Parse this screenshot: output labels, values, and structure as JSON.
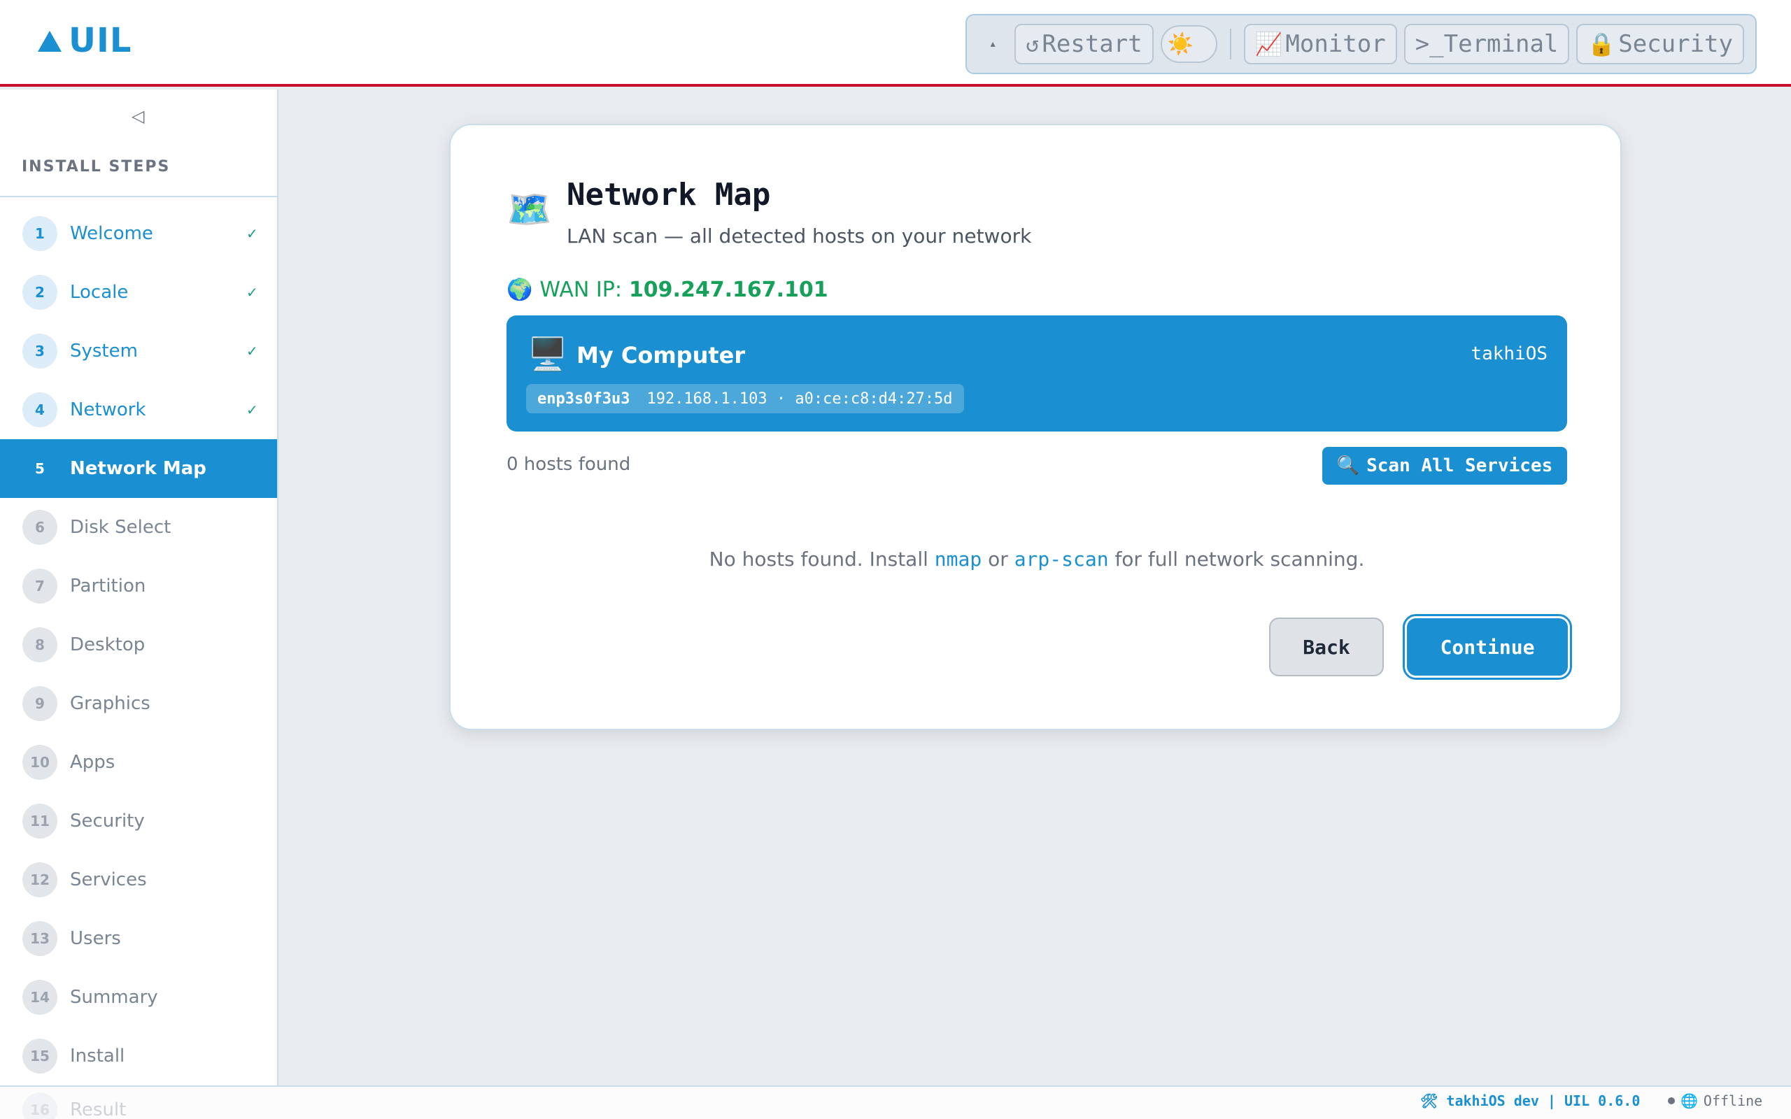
{
  "header": {
    "logo": "UIL",
    "toolbar": {
      "caret": "▴",
      "restart_icon": "↺",
      "restart_label": "Restart",
      "theme_icon": "☀️",
      "monitor_icon": "📈",
      "monitor_label": "Monitor",
      "terminal_label": ">_Terminal",
      "security_icon": "🔒",
      "security_label": "Security"
    }
  },
  "sidebar": {
    "collapse_icon": "◁",
    "title": "INSTALL STEPS",
    "steps": [
      {
        "num": "1",
        "label": "Welcome",
        "state": "done",
        "check": "✓"
      },
      {
        "num": "2",
        "label": "Locale",
        "state": "done",
        "check": "✓"
      },
      {
        "num": "3",
        "label": "System",
        "state": "done",
        "check": "✓"
      },
      {
        "num": "4",
        "label": "Network",
        "state": "done",
        "check": "✓"
      },
      {
        "num": "5",
        "label": "Network Map",
        "state": "active",
        "check": ""
      },
      {
        "num": "6",
        "label": "Disk Select",
        "state": "pending",
        "check": ""
      },
      {
        "num": "7",
        "label": "Partition",
        "state": "pending",
        "check": ""
      },
      {
        "num": "8",
        "label": "Desktop",
        "state": "pending",
        "check": ""
      },
      {
        "num": "9",
        "label": "Graphics",
        "state": "pending",
        "check": ""
      },
      {
        "num": "10",
        "label": "Apps",
        "state": "pending",
        "check": ""
      },
      {
        "num": "11",
        "label": "Security",
        "state": "pending",
        "check": ""
      },
      {
        "num": "12",
        "label": "Services",
        "state": "pending",
        "check": ""
      },
      {
        "num": "13",
        "label": "Users",
        "state": "pending",
        "check": ""
      },
      {
        "num": "14",
        "label": "Summary",
        "state": "pending",
        "check": ""
      },
      {
        "num": "15",
        "label": "Install",
        "state": "pending",
        "check": ""
      }
    ],
    "ghost_step": {
      "num": "16",
      "label": "Result"
    }
  },
  "main": {
    "icon": "🗺️",
    "title": "Network Map",
    "subtitle": "LAN scan — all detected hosts on your network",
    "wan": {
      "icon": "🌍",
      "label": "WAN IP:",
      "ip": "109.247.167.101"
    },
    "computer": {
      "icon": "🖥️",
      "name": "My Computer",
      "os": "takhiOS",
      "interface": "enp3s0f3u3",
      "address": "192.168.1.103 · a0:ce:c8:d4:27:5d"
    },
    "hosts_count": "0 hosts found",
    "scan_icon": "🔍",
    "scan_label": "Scan All Services",
    "no_hosts": {
      "prefix": "No hosts found. Install ",
      "tool1": "nmap",
      "middle": " or ",
      "tool2": "arp-scan",
      "suffix": " for full network scanning."
    },
    "back_label": "Back",
    "continue_label": "Continue"
  },
  "footer": {
    "version": "🛠 takhiOS dev | UIL 0.6.0",
    "globe_icon": "🌐",
    "status": "Offline"
  },
  "colors": {
    "accent": "#1a8fd1",
    "header_rule": "#c8102e",
    "wan_green": "#16a05a",
    "background": "#e8ebef"
  }
}
